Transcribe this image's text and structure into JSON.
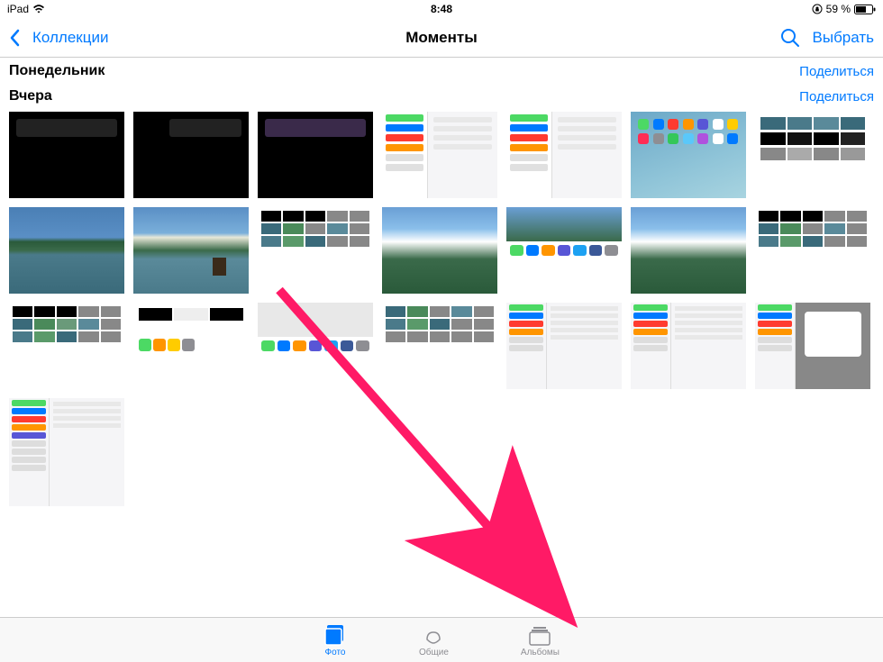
{
  "status": {
    "device": "iPad",
    "time": "8:48",
    "battery_pct": "59 %",
    "orientation_lock": true
  },
  "nav": {
    "back_label": "Коллекции",
    "title": "Моменты",
    "select_label": "Выбрать"
  },
  "sections": [
    {
      "title": "Понедельник",
      "share": "Поделиться",
      "count": 0
    },
    {
      "title": "Вчера",
      "share": "Поделиться",
      "count": 22
    }
  ],
  "thumbnails": [
    {
      "kind": "dark-dialog"
    },
    {
      "kind": "dark-dialog-2"
    },
    {
      "kind": "dark-dialog-3"
    },
    {
      "kind": "settings"
    },
    {
      "kind": "settings"
    },
    {
      "kind": "homescreen"
    },
    {
      "kind": "photos-grid"
    },
    {
      "kind": "lake"
    },
    {
      "kind": "lake-deer"
    },
    {
      "kind": "photos-grid-arrow"
    },
    {
      "kind": "mountain"
    },
    {
      "kind": "share-sheet"
    },
    {
      "kind": "mountain"
    },
    {
      "kind": "photos-grid"
    },
    {
      "kind": "photos-grid"
    },
    {
      "kind": "photos-grid-dark"
    },
    {
      "kind": "share-sheet-2"
    },
    {
      "kind": "photos-grid"
    },
    {
      "kind": "settings"
    },
    {
      "kind": "settings"
    },
    {
      "kind": "settings-popup"
    },
    {
      "kind": "settings-tall"
    }
  ],
  "tabs": {
    "photos": "Фото",
    "shared": "Общие",
    "albums": "Альбомы",
    "active": "photos"
  },
  "annotation": {
    "arrow_color": "#ff1a66"
  }
}
